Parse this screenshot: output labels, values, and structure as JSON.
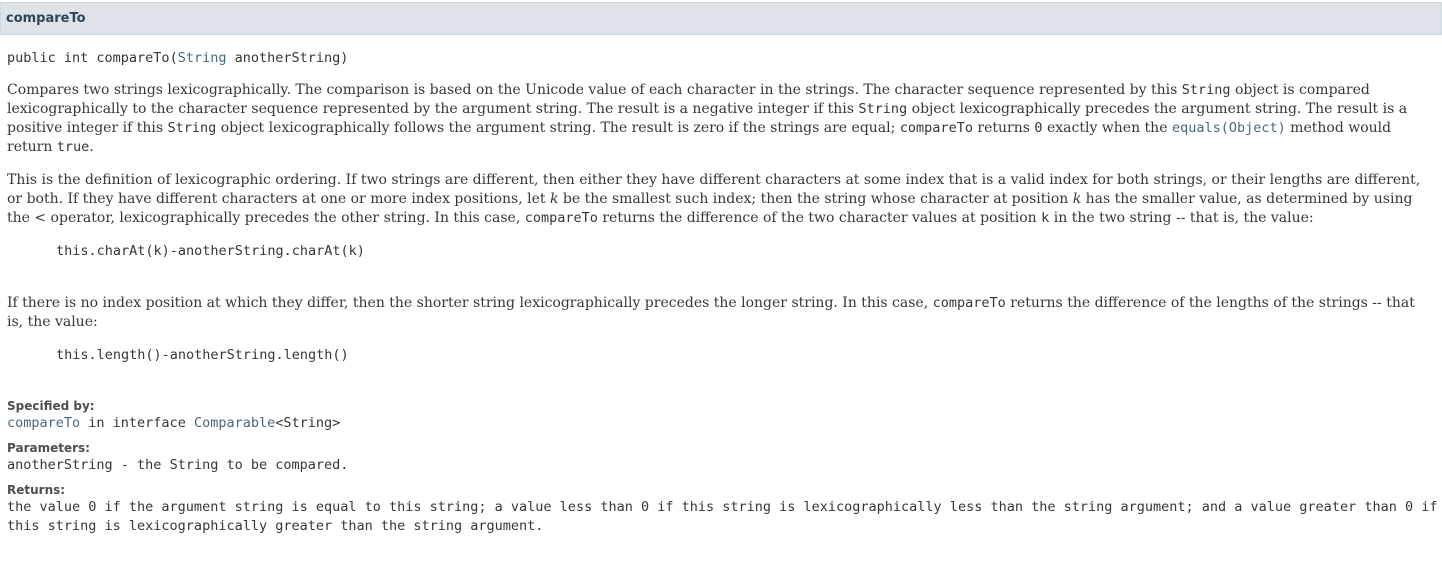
{
  "header": {
    "title": "compareTo"
  },
  "signature": {
    "prefix": "public int ",
    "method_name": "compareTo",
    "paren_open": "(",
    "param_type": "String",
    "param_rest": " anotherString)"
  },
  "para1": {
    "t1": "Compares two strings lexicographically. The comparison is based on the Unicode value of each character in the strings. The character sequence represented by this ",
    "c1": "String",
    "t2": " object is compared lexicographically to the character sequence represented by the argument string. The result is a negative integer if this ",
    "c2": "String",
    "t3": " object lexicographically precedes the argument string. The result is a positive integer if this ",
    "c3": "String",
    "t4": " object lexicographically follows the argument string. The result is zero if the strings are equal; ",
    "c4": "compareTo",
    "t5": " returns ",
    "c5": "0",
    "t6": " exactly when the ",
    "link": "equals(Object)",
    "t7": " method would return ",
    "c6": "true",
    "t8": "."
  },
  "para2": {
    "t1": "This is the definition of lexicographic ordering. If two strings are different, then either they have different characters at some index that is a valid index for both strings, or their lengths are different, or both. If they have different characters at one or more index positions, let ",
    "k1": "k",
    "t2": " be the smallest such index; then the string whose character at position ",
    "k2": "k",
    "t3": " has the smaller value, as determined by using the < operator, lexicographically precedes the other string. In this case, ",
    "c1": "compareTo",
    "t4": " returns the difference of the two character values at position ",
    "c2": "k",
    "t5": " in the two string -- that is, the value:"
  },
  "code1": "this.charAt(k)-anotherString.charAt(k)",
  "para3": {
    "t1": "If there is no index position at which they differ, then the shorter string lexicographically precedes the longer string. In this case, ",
    "c1": "compareTo",
    "t2": " returns the difference of the lengths of the strings -- that is, the value:"
  },
  "code2": "this.length()-anotherString.length()",
  "specified_by": {
    "label": "Specified by:",
    "method_link": "compareTo",
    "middle": " in interface ",
    "interface_link": "Comparable",
    "generic": "<String>"
  },
  "parameters": {
    "label": "Parameters:",
    "name": "anotherString",
    "desc": " - the String to be compared."
  },
  "returns": {
    "label": "Returns:",
    "text": "the value 0 if the argument string is equal to this string; a value less than 0 if this string is lexicographically less than the string argument; and a value greater than 0 if this string is lexicographically greater than the string argument."
  }
}
